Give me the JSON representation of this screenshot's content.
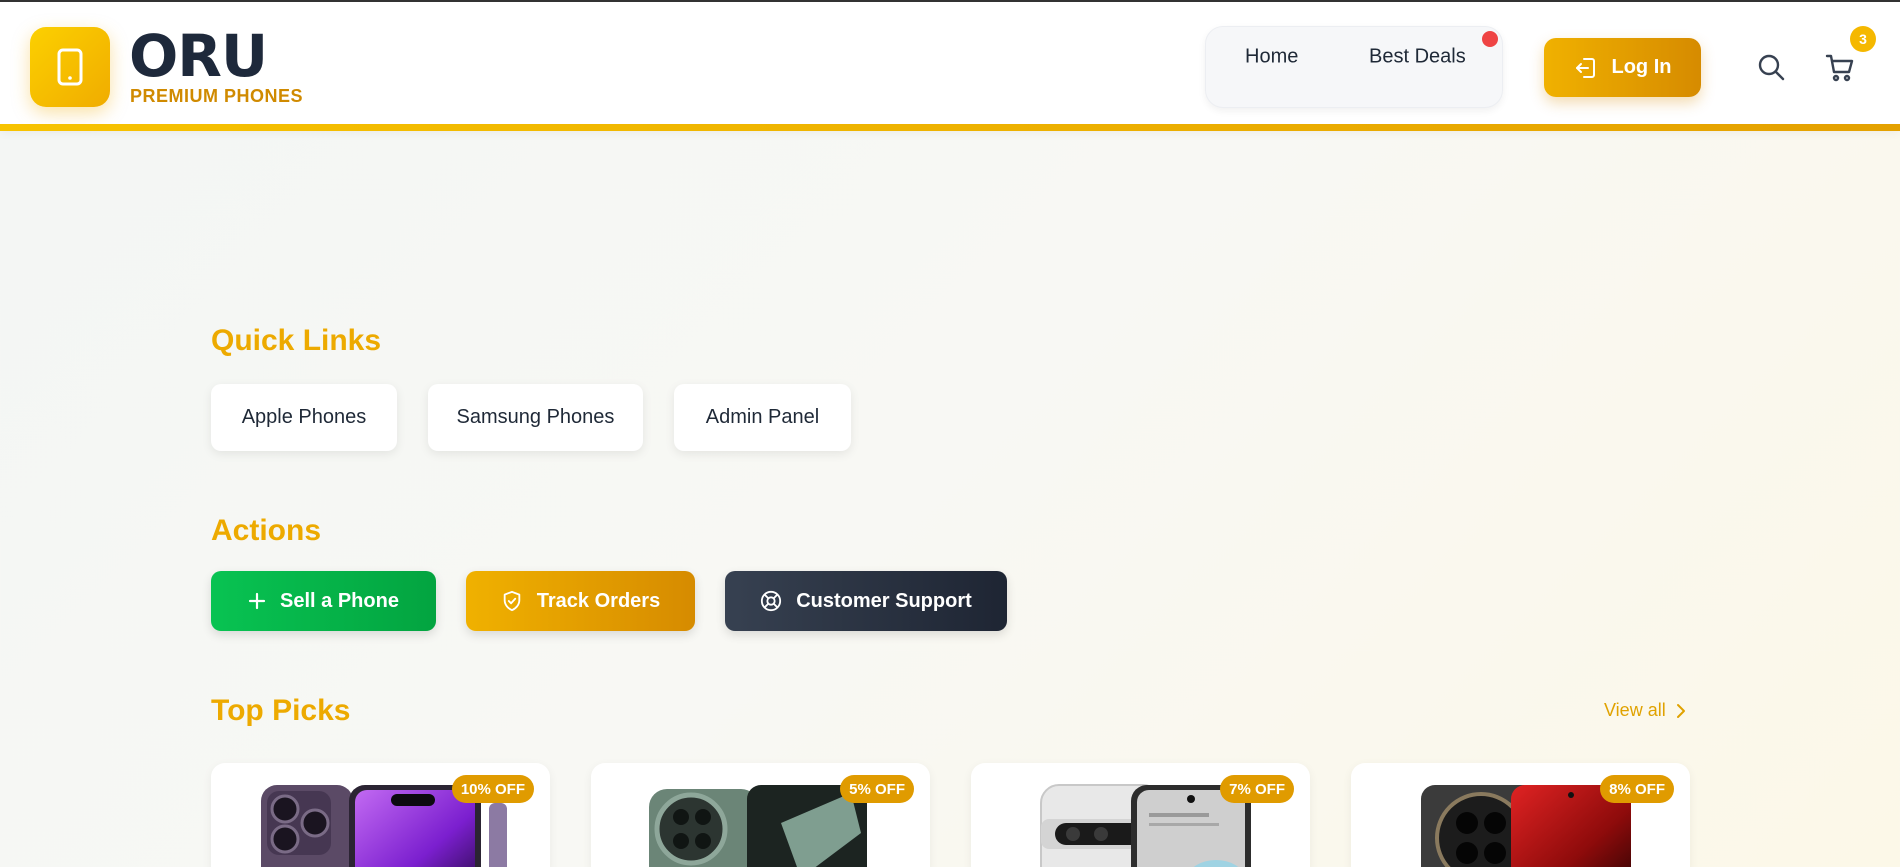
{
  "header": {
    "brand": "ORU",
    "tagline": "PREMIUM PHONES",
    "nav": [
      {
        "label": "Home"
      },
      {
        "label": "Best Deals"
      }
    ],
    "login_label": "Log In",
    "cart_count": "3",
    "accent": "#f0b100"
  },
  "quick_links": {
    "title": "Quick Links",
    "items": [
      {
        "label": "Apple Phones"
      },
      {
        "label": "Samsung Phones"
      },
      {
        "label": "Admin Panel"
      }
    ]
  },
  "actions": {
    "title": "Actions",
    "items": [
      {
        "label": "Sell a Phone",
        "icon": "plus-icon",
        "color": "#0cb94e"
      },
      {
        "label": "Track Orders",
        "icon": "shield-check-icon",
        "color": "#e5a000"
      },
      {
        "label": "Customer Support",
        "icon": "lifebuoy-icon",
        "color": "#2b3444"
      }
    ]
  },
  "top_picks": {
    "title": "Top Picks",
    "view_all": "View all",
    "products": [
      {
        "discount": "10% OFF",
        "image": "iphone-14-pro-purple"
      },
      {
        "discount": "5% OFF",
        "image": "oneplus-11-green"
      },
      {
        "discount": "7% OFF",
        "image": "pixel-7-pro-white"
      },
      {
        "discount": "8% OFF",
        "image": "xiaomi-13-ultra-black-red"
      }
    ]
  }
}
